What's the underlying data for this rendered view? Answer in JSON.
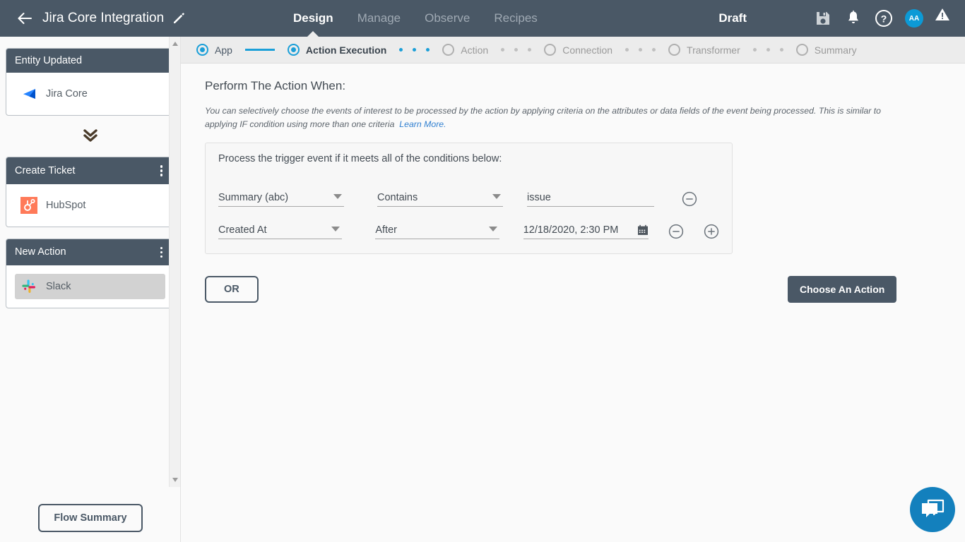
{
  "header": {
    "back_icon": "back-arrow-icon",
    "title": "Jira Core Integration",
    "edit_icon": "pencil-icon",
    "tabs": [
      {
        "label": "Design",
        "active": true
      },
      {
        "label": "Manage",
        "active": false
      },
      {
        "label": "Observe",
        "active": false
      },
      {
        "label": "Recipes",
        "active": false
      }
    ],
    "status": "Draft",
    "icons": [
      "save-icon",
      "notification-bell-icon",
      "help-icon",
      "warning-icon"
    ],
    "avatar_initials": "AA"
  },
  "sidebar": {
    "nodes": [
      {
        "title": "Entity Updated",
        "has_menu": false,
        "app": "Jira Core",
        "app_icon": "jira-core-icon",
        "selected": false
      },
      {
        "title": "Create Ticket",
        "has_menu": true,
        "app": "HubSpot",
        "app_icon": "hubspot-icon",
        "selected": false
      },
      {
        "title": "New Action",
        "has_menu": true,
        "app": "Slack",
        "app_icon": "slack-icon",
        "selected": true
      }
    ],
    "connector_icon": "double-chevron-down-icon",
    "flow_summary_label": "Flow Summary",
    "collapse_icon": "chevron-left-icon"
  },
  "stepper": {
    "steps": [
      {
        "label": "App",
        "state": "done"
      },
      {
        "label": "Action Execution",
        "state": "current"
      },
      {
        "label": "Action",
        "state": "pending"
      },
      {
        "label": "Connection",
        "state": "pending"
      },
      {
        "label": "Transformer",
        "state": "pending"
      },
      {
        "label": "Summary",
        "state": "pending"
      }
    ]
  },
  "main": {
    "page_title": "Perform The Action When:",
    "description": "You can selectively choose the events of interest to be processed by the action by applying criteria on the attributes or data fields of the event being processed. This is similar to applying IF condition using more than one criteria",
    "learn_more": "Learn More.",
    "condition_box": {
      "title": "Process the trigger event if it meets all of the conditions below:",
      "rows": [
        {
          "attribute": "Summary (abc)",
          "operator": "Contains",
          "value": "issue",
          "value_type": "text",
          "remove_icon": "minus-circle-icon"
        },
        {
          "attribute": "Created At",
          "operator": "After",
          "value": "12/18/2020, 2:30 PM",
          "value_type": "datetime",
          "calendar_icon": "calendar-icon",
          "remove_icon": "minus-circle-icon",
          "add_icon": "plus-circle-icon"
        }
      ]
    },
    "or_button": "OR",
    "choose_action_button": "Choose An Action",
    "chat_icon": "chat-bubbles-icon"
  },
  "colors": {
    "header_bg": "#4a5866",
    "accent_blue": "#1b9fd8",
    "link_blue": "#2f7fd0",
    "selected_gray": "#d2d2d2",
    "chat_blue": "#1380bd"
  }
}
